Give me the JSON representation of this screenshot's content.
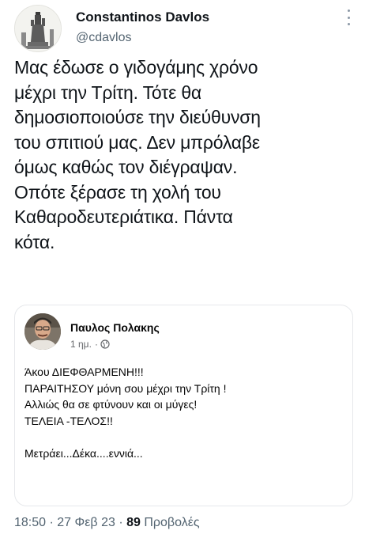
{
  "author": {
    "display_name": "Constantinos Davlos",
    "handle": "@cdavlos"
  },
  "icons": {
    "more": "more-options-icon",
    "globe": "globe-icon"
  },
  "tweet": {
    "lines": [
      "Μας έδωσε ο γιδογάμης χρόνο",
      "μέχρι την Τρίτη. Τότε θα",
      "δημοσιοποιούσε την διεύθυνση",
      "του σπιτιού μας. Δεν μπρόλαβε",
      "όμως καθώς τον διέγραψαν.",
      "Οπότε ξέρασε τη χολή του",
      "Καθαροδευτεριάτικα. Πάντα",
      "κότα."
    ]
  },
  "embedded_post": {
    "author_name": "Παυλος Πολακης",
    "time": "1 ημ.",
    "separator": "·",
    "lines": [
      "Άκου ΔΙΕΦΘΑΡΜΕΝΗ!!!",
      "ΠΑΡΑΙΤΗΣΟΥ μόνη σου μέχρι την Τρίτη !",
      "Αλλιώς θα σε φτύνουν και οι  μύγες!",
      "ΤΕΛΕΙΑ -ΤΕΛΟΣ!!",
      "",
      "Μετράει...Δέκα....εννιά..."
    ]
  },
  "footer": {
    "time": "18:50",
    "separator": "·",
    "date": "27 Φεβ 23",
    "views_count": "89",
    "views_label": "Προβολές"
  },
  "colors": {
    "text": "#0f1419",
    "muted": "#536471",
    "border": "#e6e8eb"
  }
}
